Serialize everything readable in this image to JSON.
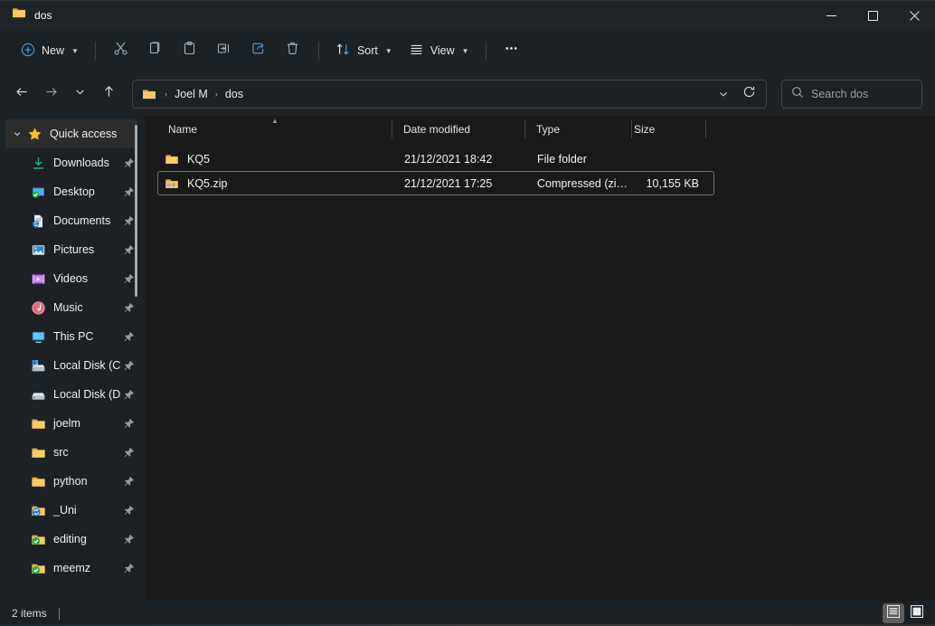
{
  "window": {
    "title": "dos",
    "title_icon": "folder-icon",
    "controls": {
      "minimize": "—",
      "maximize": "☐",
      "close": "✕"
    }
  },
  "toolbar": {
    "new_label": "New",
    "new_icon": "circle-plus-icon",
    "sort_label": "Sort",
    "sort_icon": "sort-arrows-icon",
    "view_label": "View",
    "view_icon": "list-lines-icon",
    "more_label": "•••",
    "items": [
      {
        "name": "cut-button",
        "icon": "scissors-icon"
      },
      {
        "name": "copy-button",
        "icon": "copy-icon"
      },
      {
        "name": "paste-button",
        "icon": "clipboard-icon"
      },
      {
        "name": "rename-button",
        "icon": "rename-icon"
      },
      {
        "name": "share-button",
        "icon": "share-icon"
      },
      {
        "name": "delete-button",
        "icon": "trash-icon"
      }
    ]
  },
  "navigation": {
    "back": "back-arrow-icon",
    "forward": "forward-arrow-icon",
    "recent": "chevron-down-icon",
    "up": "up-arrow-icon",
    "refresh": "refresh-icon",
    "breadcrumb": {
      "icon": "folder-icon",
      "parts": [
        "Joel M",
        "dos"
      ],
      "separator": "›"
    }
  },
  "search": {
    "placeholder": "Search dos",
    "icon": "search-icon"
  },
  "sidebar": {
    "header": {
      "label": "Quick access",
      "icon": "star-icon",
      "expander": "chevron-down-icon"
    },
    "items": [
      {
        "label": "Downloads",
        "icon": "downloads-icon",
        "pinned": true
      },
      {
        "label": "Desktop",
        "icon": "desktop-icon",
        "pinned": true
      },
      {
        "label": "Documents",
        "icon": "documents-icon",
        "pinned": true
      },
      {
        "label": "Pictures",
        "icon": "pictures-icon",
        "pinned": true
      },
      {
        "label": "Videos",
        "icon": "videos-icon",
        "pinned": true
      },
      {
        "label": "Music",
        "icon": "music-icon",
        "pinned": true
      },
      {
        "label": "This PC",
        "icon": "thispc-icon",
        "pinned": true
      },
      {
        "label": "Local Disk (C",
        "icon": "windows-disk-icon",
        "pinned": true
      },
      {
        "label": "Local Disk (D",
        "icon": "disk-icon",
        "pinned": true
      },
      {
        "label": "joelm",
        "icon": "folder-icon",
        "pinned": true
      },
      {
        "label": "src",
        "icon": "folder-icon",
        "pinned": true
      },
      {
        "label": "python",
        "icon": "folder-icon",
        "pinned": true
      },
      {
        "label": "_Uni",
        "icon": "folder-sync-icon",
        "pinned": true
      },
      {
        "label": "editing",
        "icon": "folder-check-icon",
        "pinned": true
      },
      {
        "label": "meemz",
        "icon": "folder-check-icon",
        "pinned": true
      }
    ]
  },
  "filelist": {
    "columns": [
      {
        "key": "name",
        "label": "Name",
        "sorted": true,
        "sort_dir": "asc"
      },
      {
        "key": "date",
        "label": "Date modified"
      },
      {
        "key": "type",
        "label": "Type"
      },
      {
        "key": "size",
        "label": "Size"
      }
    ],
    "rows": [
      {
        "name": "KQ5",
        "icon": "folder-icon",
        "date": "21/12/2021 18:42",
        "type": "File folder",
        "size": "",
        "focused": false
      },
      {
        "name": "KQ5.zip",
        "icon": "zip-folder-icon",
        "date": "21/12/2021 17:25",
        "type": "Compressed (zipp...",
        "size": "10,155 KB",
        "focused": true
      }
    ]
  },
  "statusbar": {
    "item_count": "2 items",
    "views": [
      {
        "name": "details-view-button",
        "icon": "details-view-icon",
        "selected": true
      },
      {
        "name": "large-icons-view-button",
        "icon": "large-icons-view-icon",
        "selected": false
      }
    ]
  },
  "colors": {
    "titlebar": "#1e2427",
    "toolbar": "#1c2125",
    "content": "#191919",
    "accent": "#4da3e8",
    "folder": "#f6c454",
    "text": "#f0f0f0"
  }
}
